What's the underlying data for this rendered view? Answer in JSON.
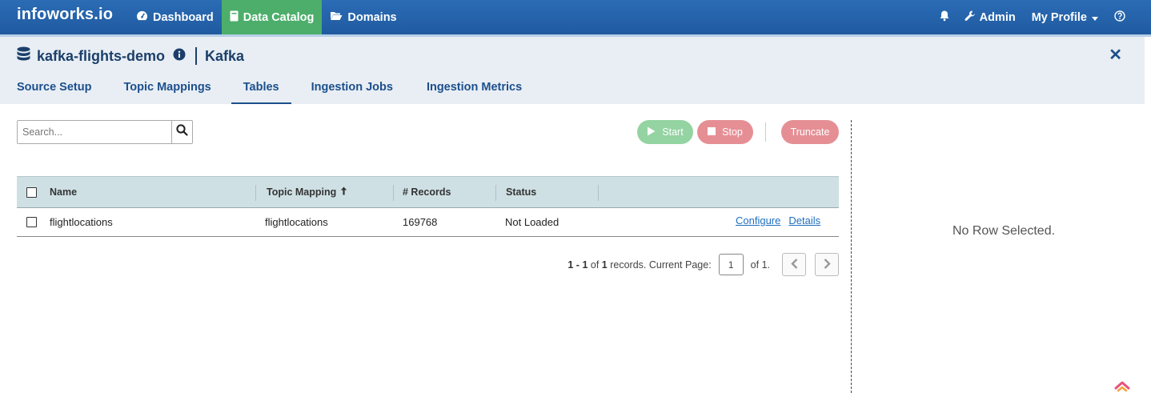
{
  "navbar": {
    "brand": "infoworks.io",
    "items": [
      {
        "label": "Dashboard",
        "icon": "dashboard-icon"
      },
      {
        "label": "Data Catalog",
        "icon": "book-icon",
        "active": true
      },
      {
        "label": "Domains",
        "icon": "folder-open-icon"
      }
    ],
    "admin_label": "Admin",
    "profile_label": "My Profile",
    "accent_active": "#4cae6a"
  },
  "source": {
    "name": "kafka-flights-demo",
    "type": "Kafka"
  },
  "tabs": [
    {
      "label": "Source Setup"
    },
    {
      "label": "Topic Mappings"
    },
    {
      "label": "Tables",
      "active": true
    },
    {
      "label": "Ingestion Jobs"
    },
    {
      "label": "Ingestion Metrics"
    }
  ],
  "search": {
    "placeholder": "Search...",
    "value": ""
  },
  "actions": {
    "start_label": "Start",
    "stop_label": "Stop",
    "truncate_label": "Truncate"
  },
  "table": {
    "headers": {
      "name": "Name",
      "topic_mapping": "Topic Mapping",
      "records": "# Records",
      "status": "Status"
    },
    "rows": [
      {
        "name": "flightlocations",
        "topic_mapping": "flightlocations",
        "records": "169768",
        "status": "Not Loaded",
        "configure_label": "Configure",
        "details_label": "Details"
      }
    ]
  },
  "pagination": {
    "range_start": "1",
    "range_end": "1",
    "total": "1",
    "records_text": "records. Current Page:",
    "current_page": "1",
    "of_pages": "of 1."
  },
  "details_panel": {
    "empty_text": "No Row Selected."
  }
}
